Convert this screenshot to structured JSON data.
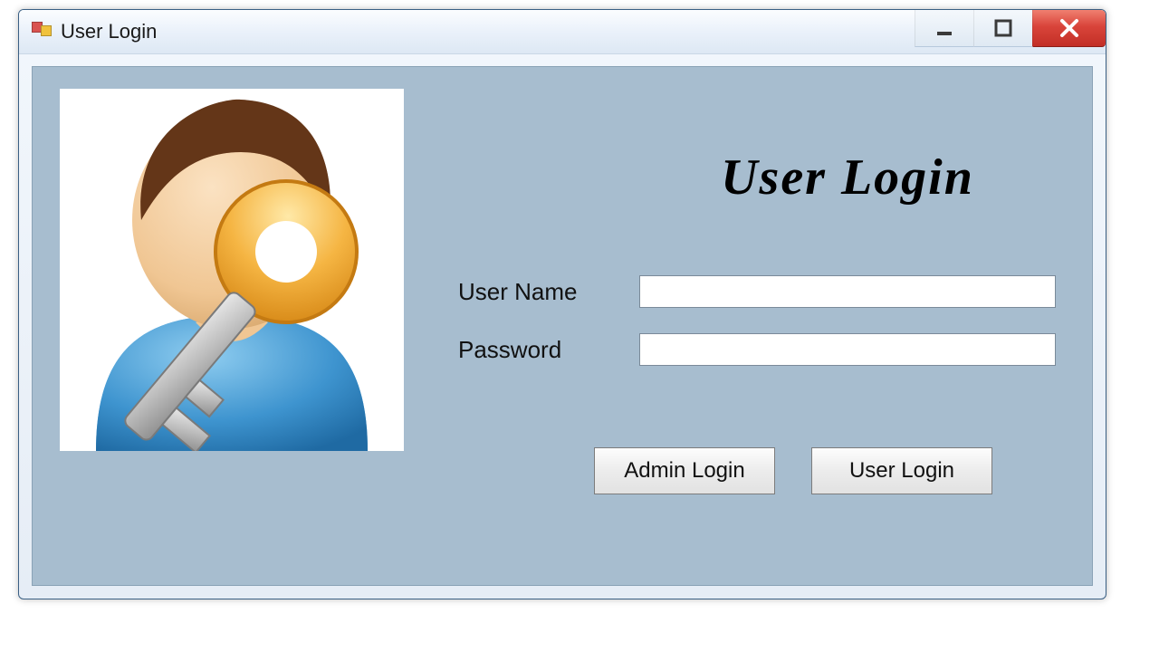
{
  "window": {
    "title": "User Login"
  },
  "heading": "User Login",
  "form": {
    "username_label": "User Name",
    "username_value": "",
    "password_label": "Password",
    "password_value": ""
  },
  "buttons": {
    "admin_login": "Admin Login",
    "user_login": "User Login"
  },
  "icons": {
    "app": "app-icon",
    "minimize": "minimize-icon",
    "maximize": "maximize-icon",
    "close": "close-icon",
    "user_key": "user-key-icon"
  }
}
